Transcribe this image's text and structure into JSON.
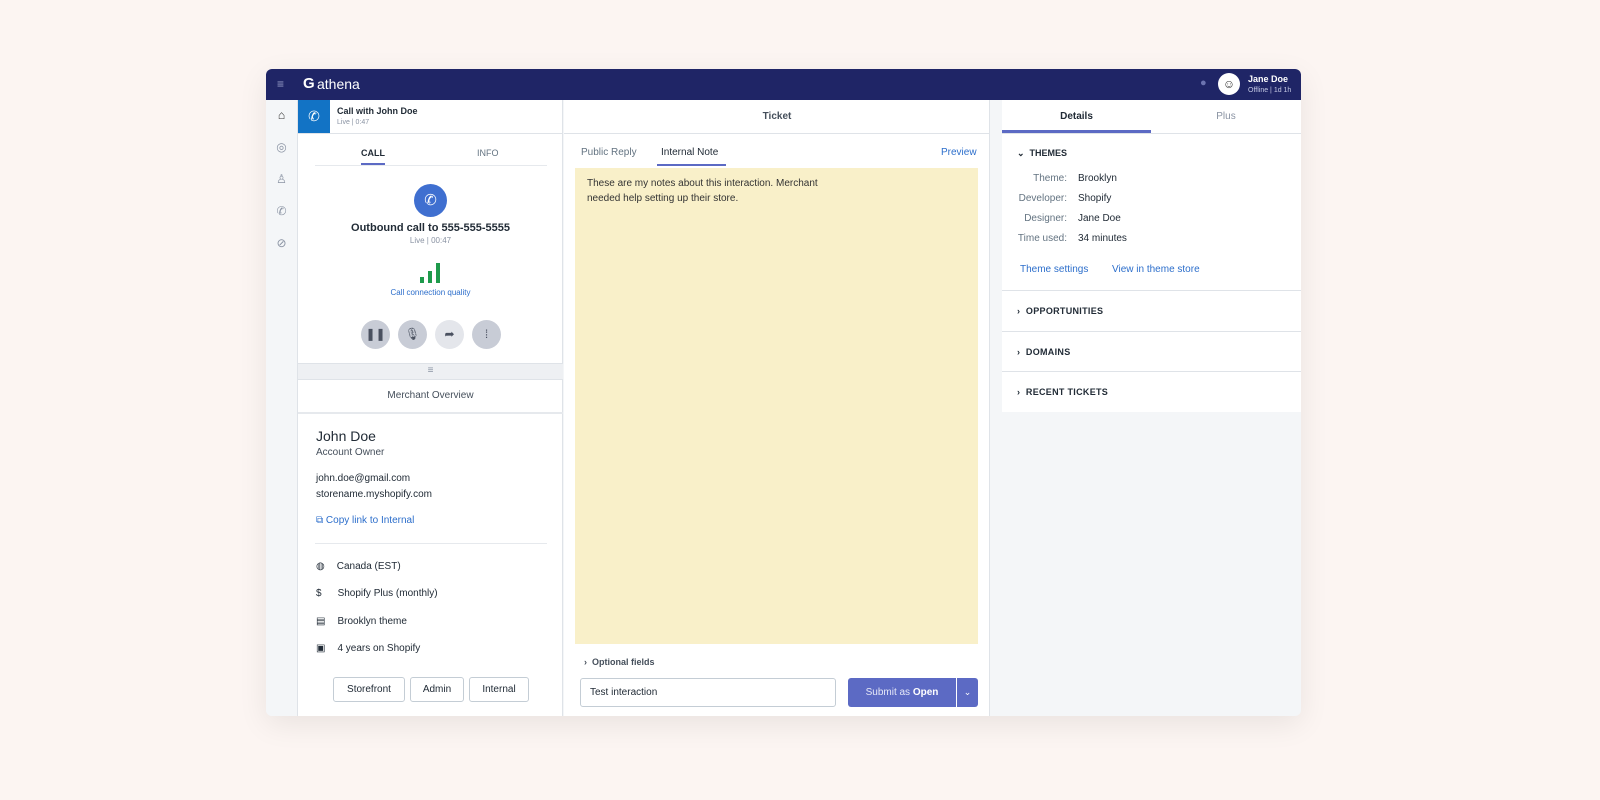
{
  "header": {
    "brand": "athena",
    "user_name": "Jane Doe",
    "user_status": "Offline | 1d 1h"
  },
  "call_bar": {
    "title": "Call with John Doe",
    "status": "Live | 0:47"
  },
  "call_tabs": [
    "CALL",
    "INFO"
  ],
  "call": {
    "title": "Outbound call to 555-555-5555",
    "status": "Live | 00:47",
    "quality_label": "Call connection quality"
  },
  "merchant": {
    "section_title": "Merchant Overview",
    "name": "John Doe",
    "role": "Account Owner",
    "email": "john.doe@gmail.com",
    "store": "storename.myshopify.com",
    "copy_link": "Copy link to Internal",
    "facts": [
      "Canada (EST)",
      "Shopify Plus (monthly)",
      "Brooklyn theme",
      "4 years on Shopify"
    ],
    "buttons": [
      "Storefront",
      "Admin",
      "Internal"
    ]
  },
  "ticket": {
    "title": "Ticket",
    "tabs": [
      "Public Reply",
      "Internal Note"
    ],
    "active_tab": "Internal Note",
    "preview": "Preview",
    "note": "These are my notes about this interaction. Merchant needed help setting up their store.",
    "optional_fields": "Optional fields",
    "subject_value": "Test interaction",
    "submit_prefix": "Submit as ",
    "submit_status": "Open"
  },
  "details": {
    "tabs": [
      "Details",
      "Plus"
    ],
    "themes_title": "THEMES",
    "rows": [
      {
        "label": "Theme:",
        "value": "Brooklyn"
      },
      {
        "label": "Developer:",
        "value": "Shopify"
      },
      {
        "label": "Designer:",
        "value": "Jane Doe"
      },
      {
        "label": "Time used:",
        "value": "34 minutes"
      }
    ],
    "links": [
      "Theme settings",
      "View in theme store"
    ],
    "sections": [
      "OPPORTUNITIES",
      "DOMAINS",
      "RECENT TICKETS"
    ]
  },
  "colors": {
    "navy": "#1f2566",
    "accent": "#5c6ac4",
    "note_bg": "#f9f0c9",
    "signal": "#1e9a4b"
  }
}
